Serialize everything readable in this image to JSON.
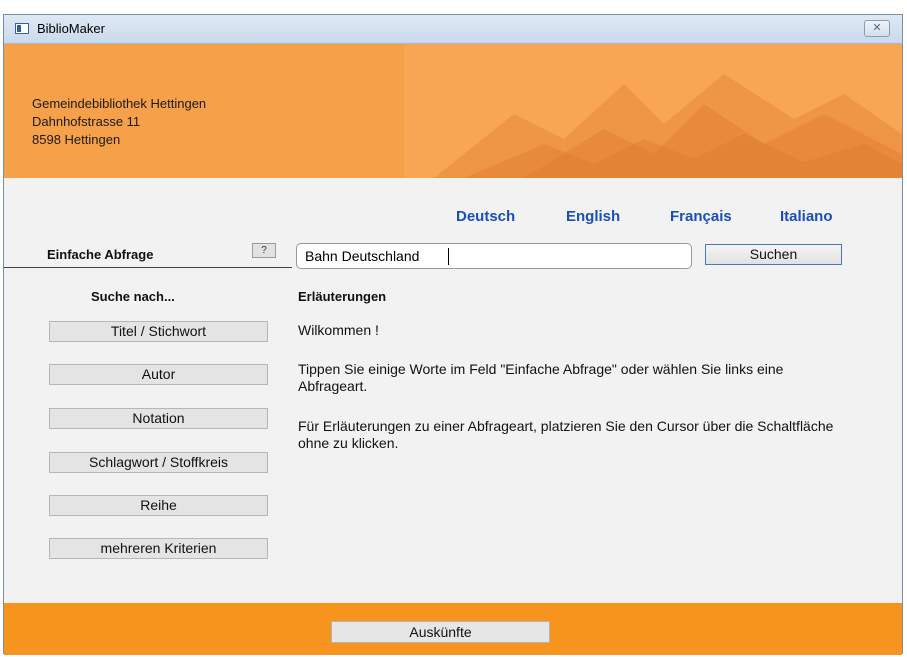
{
  "window": {
    "title": "BiblioMaker",
    "close_glyph": "✕"
  },
  "library": {
    "name": "Gemeindebibliothek Hettingen",
    "street": "Dahnhofstrasse 11",
    "city": "8598 Hettingen"
  },
  "languages": [
    "Deutsch",
    "English",
    "Français",
    "Italiano"
  ],
  "query": {
    "label": "Einfache Abfrage",
    "help_label": "?",
    "value": "Bahn Deutschland",
    "search_label": "Suchen"
  },
  "search_by": {
    "heading": "Suche nach...",
    "buttons": [
      "Titel / Stichwort",
      "Autor",
      "Notation",
      "Schlagwort / Stoffkreis",
      "Reihe",
      "mehreren Kriterien"
    ]
  },
  "explanations": {
    "heading": "Erläuterungen",
    "welcome": "Wilkommen !",
    "para1": "Tippen Sie einige Worte im Feld \"Einfache Abfrage\" oder wählen Sie links eine Abfrageart.",
    "para2": "Für Erläuterungen zu einer Abfrageart, platzieren Sie den Cursor über die Schaltfläche ohne zu klicken."
  },
  "footer": {
    "info_label": "Auskünfte"
  },
  "colors": {
    "banner": "#f7a04a",
    "footer": "#f7941d",
    "language_link": "#1a4fb8"
  }
}
